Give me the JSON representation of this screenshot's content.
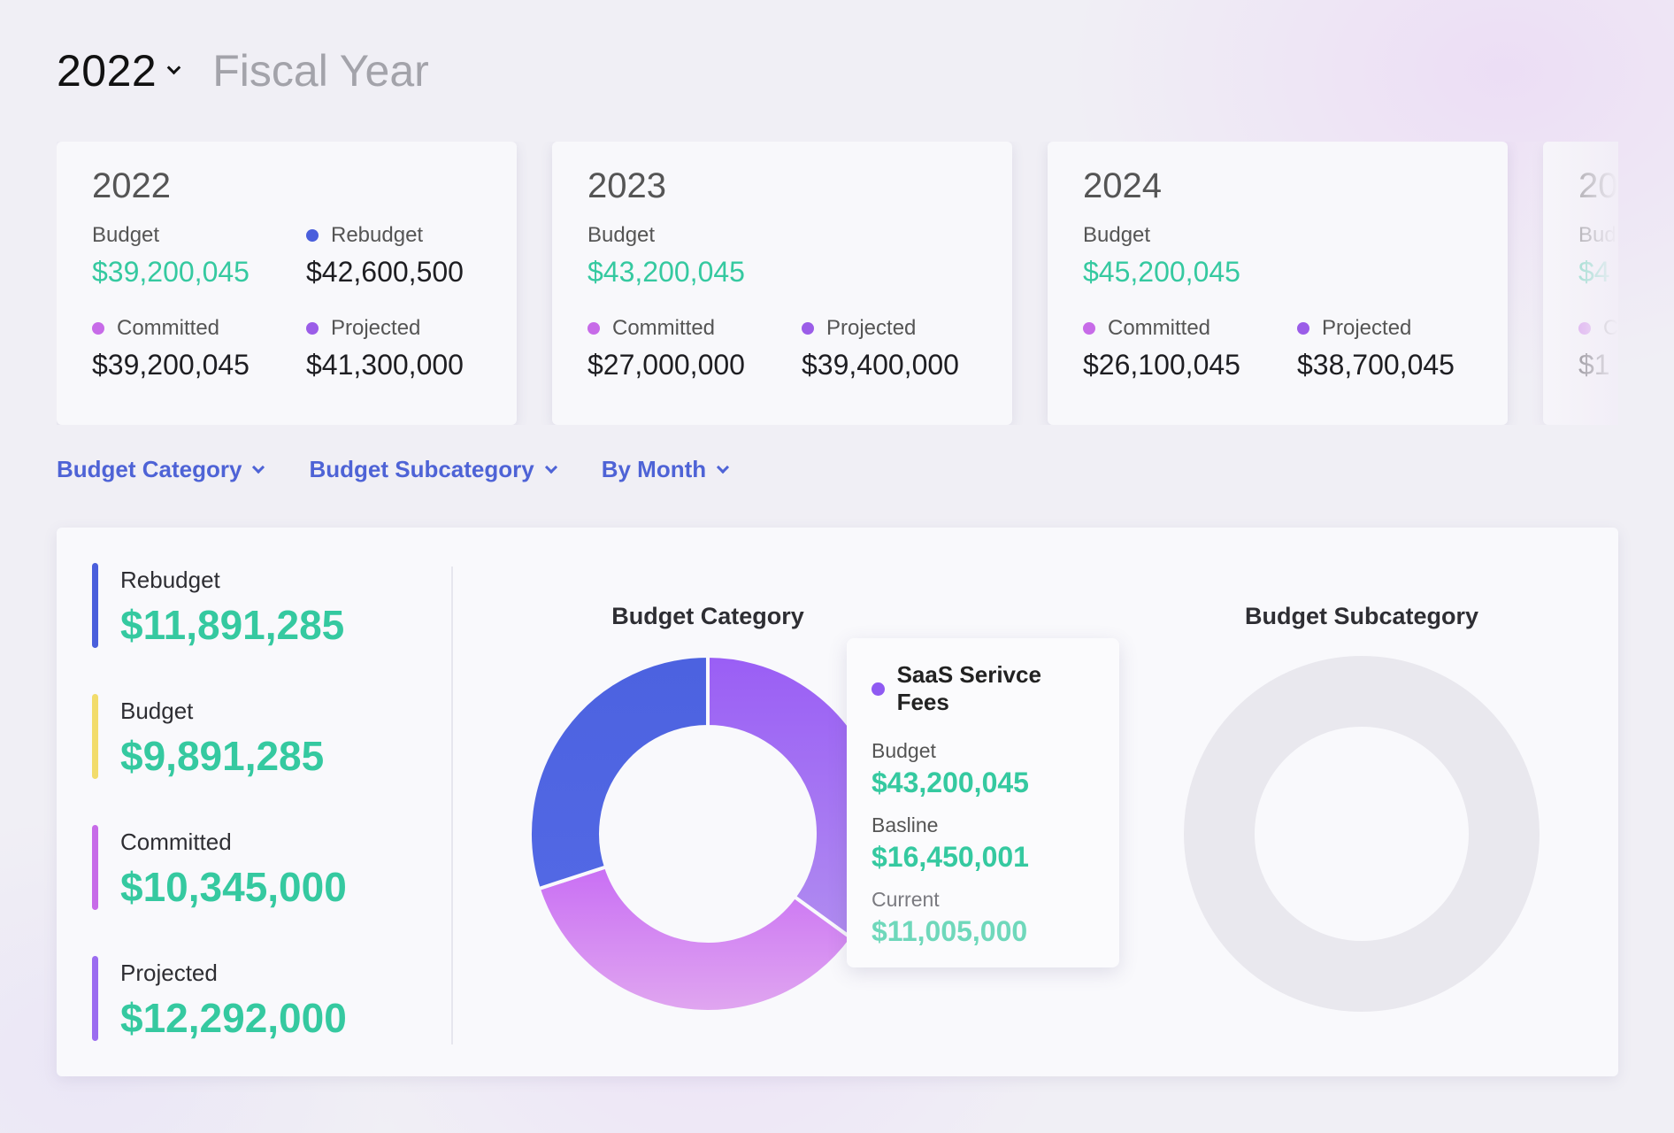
{
  "header": {
    "year": "2022",
    "subtitle": "Fiscal Year"
  },
  "year_cards": [
    {
      "year": "2022",
      "metrics": [
        {
          "label": "Budget",
          "value": "$39,200,045",
          "dot": "",
          "highlight": true
        },
        {
          "label": "Rebudget",
          "value": "$42,600,500",
          "dot": "#4a5fdc",
          "highlight": false
        },
        {
          "label": "Committed",
          "value": "$39,200,045",
          "dot": "#c76be8",
          "highlight": false
        },
        {
          "label": "Projected",
          "value": "$41,300,000",
          "dot": "#9b5de8",
          "highlight": false
        }
      ]
    },
    {
      "year": "2023",
      "metrics": [
        {
          "label": "Budget",
          "value": "$43,200,045",
          "dot": "",
          "highlight": true
        },
        {
          "label": "",
          "value": "",
          "dot": "",
          "highlight": false
        },
        {
          "label": "Committed",
          "value": "$27,000,000",
          "dot": "#c76be8",
          "highlight": false
        },
        {
          "label": "Projected",
          "value": "$39,400,000",
          "dot": "#9b5de8",
          "highlight": false
        }
      ]
    },
    {
      "year": "2024",
      "metrics": [
        {
          "label": "Budget",
          "value": "$45,200,045",
          "dot": "",
          "highlight": true
        },
        {
          "label": "",
          "value": "",
          "dot": "",
          "highlight": false
        },
        {
          "label": "Committed",
          "value": "$26,100,045",
          "dot": "#c76be8",
          "highlight": false
        },
        {
          "label": "Projected",
          "value": "$38,700,045",
          "dot": "#9b5de8",
          "highlight": false
        }
      ]
    },
    {
      "year": "20",
      "metrics": [
        {
          "label": "Bud",
          "value": "$4",
          "dot": "",
          "highlight": true
        },
        {
          "label": "",
          "value": "",
          "dot": "",
          "highlight": false
        },
        {
          "label": "C",
          "value": "$1",
          "dot": "#c76be8",
          "highlight": false
        },
        {
          "label": "",
          "value": "",
          "dot": "",
          "highlight": false
        }
      ]
    }
  ],
  "filters": [
    "Budget Category",
    "Budget Subcategory",
    "By Month"
  ],
  "summary": [
    {
      "label": "Rebudget",
      "value": "$11,891,285",
      "color": "#4a5fdc"
    },
    {
      "label": "Budget",
      "value": "$9,891,285",
      "color": "#f2dc6b"
    },
    {
      "label": "Committed",
      "value": "$10,345,000",
      "color": "#c76be8"
    },
    {
      "label": "Projected",
      "value": "$12,292,000",
      "color": "#9b6cf0"
    }
  ],
  "charts": {
    "category_title": "Budget Category",
    "subcategory_title": "Budget Subcategory"
  },
  "chart_data": [
    {
      "type": "pie",
      "title": "Budget Category",
      "slices": [
        {
          "value": 0.35,
          "color": "#9560f4"
        },
        {
          "value": 0.35,
          "color": "#cf7ef2"
        },
        {
          "value": 0.3,
          "color": "#4e66e2"
        }
      ]
    },
    {
      "type": "pie",
      "title": "Budget Subcategory",
      "slices": [
        {
          "value": 1.0,
          "color": "#e9e8ee"
        }
      ]
    }
  ],
  "tooltip": {
    "title": "SaaS Serivce Fees",
    "rows": [
      {
        "label": "Budget",
        "value": "$43,200,045"
      },
      {
        "label": "Basline",
        "value": "$16,450,001"
      },
      {
        "label": "Current",
        "value": "$11,005,000"
      }
    ]
  }
}
